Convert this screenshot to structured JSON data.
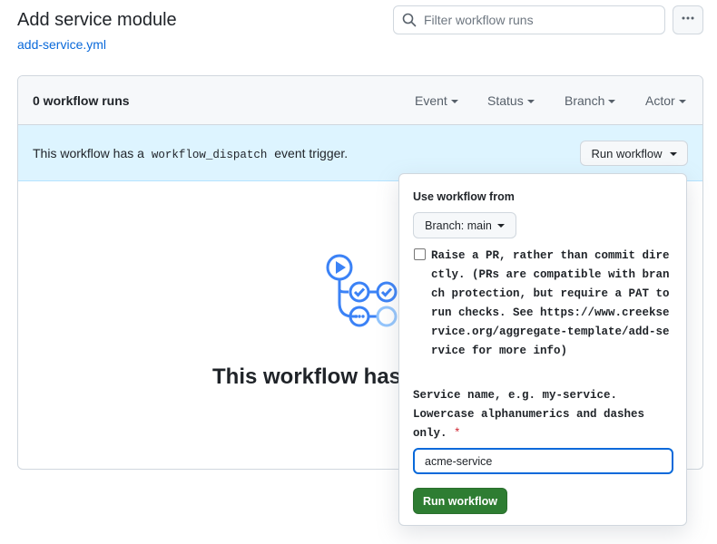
{
  "page": {
    "title": "Add service module",
    "file_link": "add-service.yml"
  },
  "search": {
    "placeholder": "Filter workflow runs",
    "value": ""
  },
  "runs": {
    "count_label": "0 workflow runs",
    "filters": [
      "Event",
      "Status",
      "Branch",
      "Actor"
    ]
  },
  "dispatch": {
    "text_before": "This workflow has a",
    "code": "workflow_dispatch",
    "text_after": "event trigger.",
    "run_button": "Run workflow"
  },
  "empty_state": {
    "title": "This workflow has n",
    "icon": "workflow-graph-icon"
  },
  "popover": {
    "use_from_label": "Use workflow from",
    "branch_button": "Branch: main",
    "checkbox_checked": false,
    "checkbox_label": "Raise a PR, rather than commit directly. (PRs are compatible with branch protection, but require a PAT to run checks. See https://www.creekservice.org/aggregate-template/add-service for more info)",
    "field_label": "Service name, e.g. my-service. Lowercase alphanumerics and dashes only.",
    "required_marker": "*",
    "field_value": "acme-service",
    "submit_button": "Run workflow"
  },
  "colors": {
    "accent_blue": "#0969da",
    "info_bg": "#ddf4ff",
    "success_green": "#2e7d32",
    "icon_blue": "#3b82f6",
    "danger_red": "#cf222e"
  }
}
